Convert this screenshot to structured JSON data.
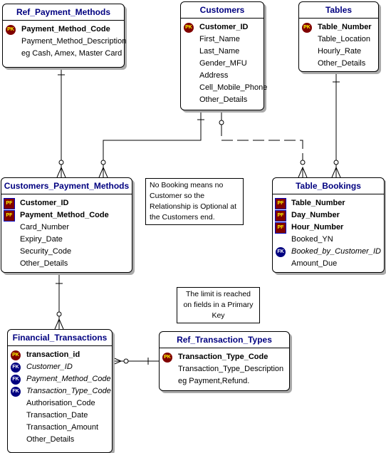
{
  "entities": {
    "ref_payment_methods": {
      "title": "Ref_Payment_Methods",
      "rows": [
        {
          "k": "pk",
          "n": "Payment_Method_Code",
          "s": "b"
        },
        {
          "k": "none",
          "n": "Payment_Method_Description",
          "s": ""
        },
        {
          "k": "none",
          "n": "eg Cash, Amex, Master Card",
          "s": ""
        }
      ]
    },
    "customers": {
      "title": "Customers",
      "rows": [
        {
          "k": "pk",
          "n": "Customer_ID",
          "s": "b"
        },
        {
          "k": "none",
          "n": "First_Name",
          "s": ""
        },
        {
          "k": "none",
          "n": "Last_Name",
          "s": ""
        },
        {
          "k": "none",
          "n": "Gender_MFU",
          "s": ""
        },
        {
          "k": "none",
          "n": "Address",
          "s": ""
        },
        {
          "k": "none",
          "n": "Cell_Mobile_Phone",
          "s": ""
        },
        {
          "k": "none",
          "n": "Other_Details",
          "s": ""
        }
      ]
    },
    "tables": {
      "title": "Tables",
      "rows": [
        {
          "k": "pk",
          "n": "Table_Number",
          "s": "b"
        },
        {
          "k": "none",
          "n": "Table_Location",
          "s": ""
        },
        {
          "k": "none",
          "n": "Hourly_Rate",
          "s": ""
        },
        {
          "k": "none",
          "n": "Other_Details",
          "s": ""
        }
      ]
    },
    "customers_payment_methods": {
      "title": "Customers_Payment_Methods",
      "rows": [
        {
          "k": "pf",
          "n": "Customer_ID",
          "s": "b"
        },
        {
          "k": "pf",
          "n": "Payment_Method_Code",
          "s": "b"
        },
        {
          "k": "none",
          "n": "Card_Number",
          "s": ""
        },
        {
          "k": "none",
          "n": "Expiry_Date",
          "s": ""
        },
        {
          "k": "none",
          "n": "Security_Code",
          "s": ""
        },
        {
          "k": "none",
          "n": "Other_Details",
          "s": ""
        }
      ]
    },
    "table_bookings": {
      "title": "Table_Bookings",
      "rows": [
        {
          "k": "pf",
          "n": "Table_Number",
          "s": "b"
        },
        {
          "k": "pf",
          "n": "Day_Number",
          "s": "b"
        },
        {
          "k": "pf",
          "n": "Hour_Number",
          "s": "b"
        },
        {
          "k": "none",
          "n": "Booked_YN",
          "s": ""
        },
        {
          "k": "fk",
          "n": "Booked_by_Customer_ID",
          "s": "i"
        },
        {
          "k": "none",
          "n": "Amount_Due",
          "s": ""
        }
      ]
    },
    "financial_transactions": {
      "title": "Financial_Transactions",
      "rows": [
        {
          "k": "pk",
          "n": "transaction_id",
          "s": "b"
        },
        {
          "k": "fk",
          "n": "Customer_ID",
          "s": "i"
        },
        {
          "k": "fk",
          "n": "Payment_Method_Code",
          "s": "i"
        },
        {
          "k": "fk",
          "n": "Transaction_Type_Code",
          "s": "i"
        },
        {
          "k": "none",
          "n": "Authorisation_Code",
          "s": ""
        },
        {
          "k": "none",
          "n": "Transaction_Date",
          "s": ""
        },
        {
          "k": "none",
          "n": "Transaction_Amount",
          "s": ""
        },
        {
          "k": "none",
          "n": "Other_Details",
          "s": ""
        }
      ]
    },
    "ref_transaction_types": {
      "title": "Ref_Transaction_Types",
      "rows": [
        {
          "k": "pk",
          "n": "Transaction_Type_Code",
          "s": "b"
        },
        {
          "k": "none",
          "n": "Transaction_Type_Description",
          "s": ""
        },
        {
          "k": "none",
          "n": "eg Payment,Refund.",
          "s": ""
        }
      ]
    }
  },
  "icon_labels": {
    "pk": "PK",
    "pf": "PF",
    "fk": "FK",
    "none": ""
  },
  "notes": {
    "optional": "No Booking means no Customer so the Relationship is Optional at the Customers end.",
    "limit": "The limit is reached on fields in a Primary Key"
  }
}
